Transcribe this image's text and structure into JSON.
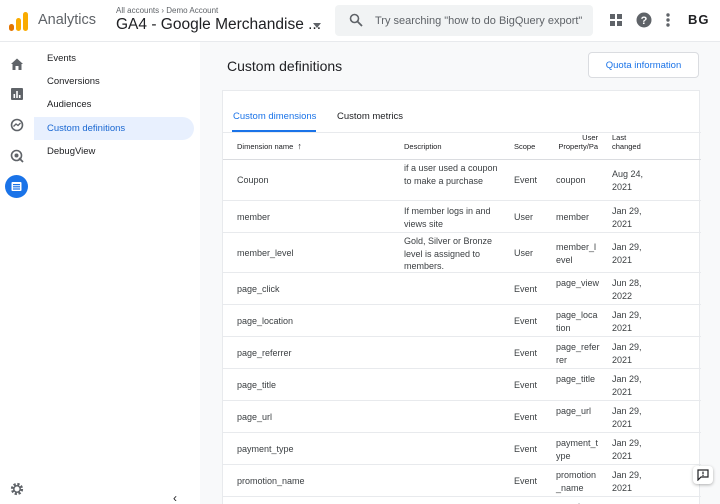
{
  "header": {
    "app_name": "Analytics",
    "breadcrumb": "All accounts › Demo Account",
    "property_name": "GA4 - Google Merchandise ...",
    "search_placeholder": "Try searching \"how to do BigQuery export\"",
    "avatar_initials": "BG",
    "icons": [
      "analytics-logo-icon",
      "search-icon",
      "apps-grid-icon",
      "help-icon",
      "more-vert-icon"
    ]
  },
  "rail": {
    "items": [
      "home-icon",
      "reports-icon",
      "explore-icon",
      "advertising-icon",
      "configure-icon"
    ],
    "bottom": "settings-icon"
  },
  "nav": {
    "items": [
      {
        "label": "Events"
      },
      {
        "label": "Conversions"
      },
      {
        "label": "Audiences"
      },
      {
        "label": "Custom definitions",
        "active": true
      },
      {
        "label": "DebugView"
      }
    ]
  },
  "main": {
    "title": "Custom definitions",
    "quota_button": "Quota information",
    "tabs": [
      {
        "label": "Custom dimensions",
        "active": true
      },
      {
        "label": "Custom metrics",
        "active": false
      }
    ]
  },
  "table": {
    "headers": {
      "name": "Dimension name",
      "sort_arrow": "↑",
      "description": "Description",
      "scope": "Scope",
      "user_property": "User\nProperty/Pa",
      "last_changed": "Last\nchanged"
    },
    "rows": [
      {
        "name": "Coupon",
        "description": "if a user used a coupon to make a purchase",
        "scope": "Event",
        "user_property": "coupon",
        "last_changed": "Aug 24, 2021"
      },
      {
        "name": "member",
        "description": "If member logs in and views site",
        "scope": "User",
        "user_property": "member",
        "last_changed": "Jan 29, 2021"
      },
      {
        "name": "member_level",
        "description": "Gold, Silver or Bronze level is assigned to members.",
        "scope": "User",
        "user_property": "member_level",
        "last_changed": "Jan 29, 2021"
      },
      {
        "name": "page_click",
        "description": "",
        "scope": "Event",
        "user_property": "page_view",
        "last_changed": "Jun 28, 2022"
      },
      {
        "name": "page_location",
        "description": "",
        "scope": "Event",
        "user_property": "page_location",
        "last_changed": "Jan 29, 2021"
      },
      {
        "name": "page_referrer",
        "description": "",
        "scope": "Event",
        "user_property": "page_referrer",
        "last_changed": "Jan 29, 2021"
      },
      {
        "name": "page_title",
        "description": "",
        "scope": "Event",
        "user_property": "page_title",
        "last_changed": "Jan 29, 2021"
      },
      {
        "name": "page_url",
        "description": "",
        "scope": "Event",
        "user_property": "page_url",
        "last_changed": "Jan 29, 2021"
      },
      {
        "name": "payment_type",
        "description": "",
        "scope": "Event",
        "user_property": "payment_type",
        "last_changed": "Jan 29, 2021"
      },
      {
        "name": "promotion_name",
        "description": "",
        "scope": "Event",
        "user_property": "promotion_name",
        "last_changed": "Jan 29, 2021"
      },
      {
        "name": "",
        "description": "",
        "scope": "",
        "user_property": "search_te",
        "last_changed": "May 7,"
      }
    ]
  },
  "colors": {
    "accent": "#1a73e8",
    "active_nav_bg": "#e8f0fe",
    "logo_orange": "#f9ab00"
  }
}
